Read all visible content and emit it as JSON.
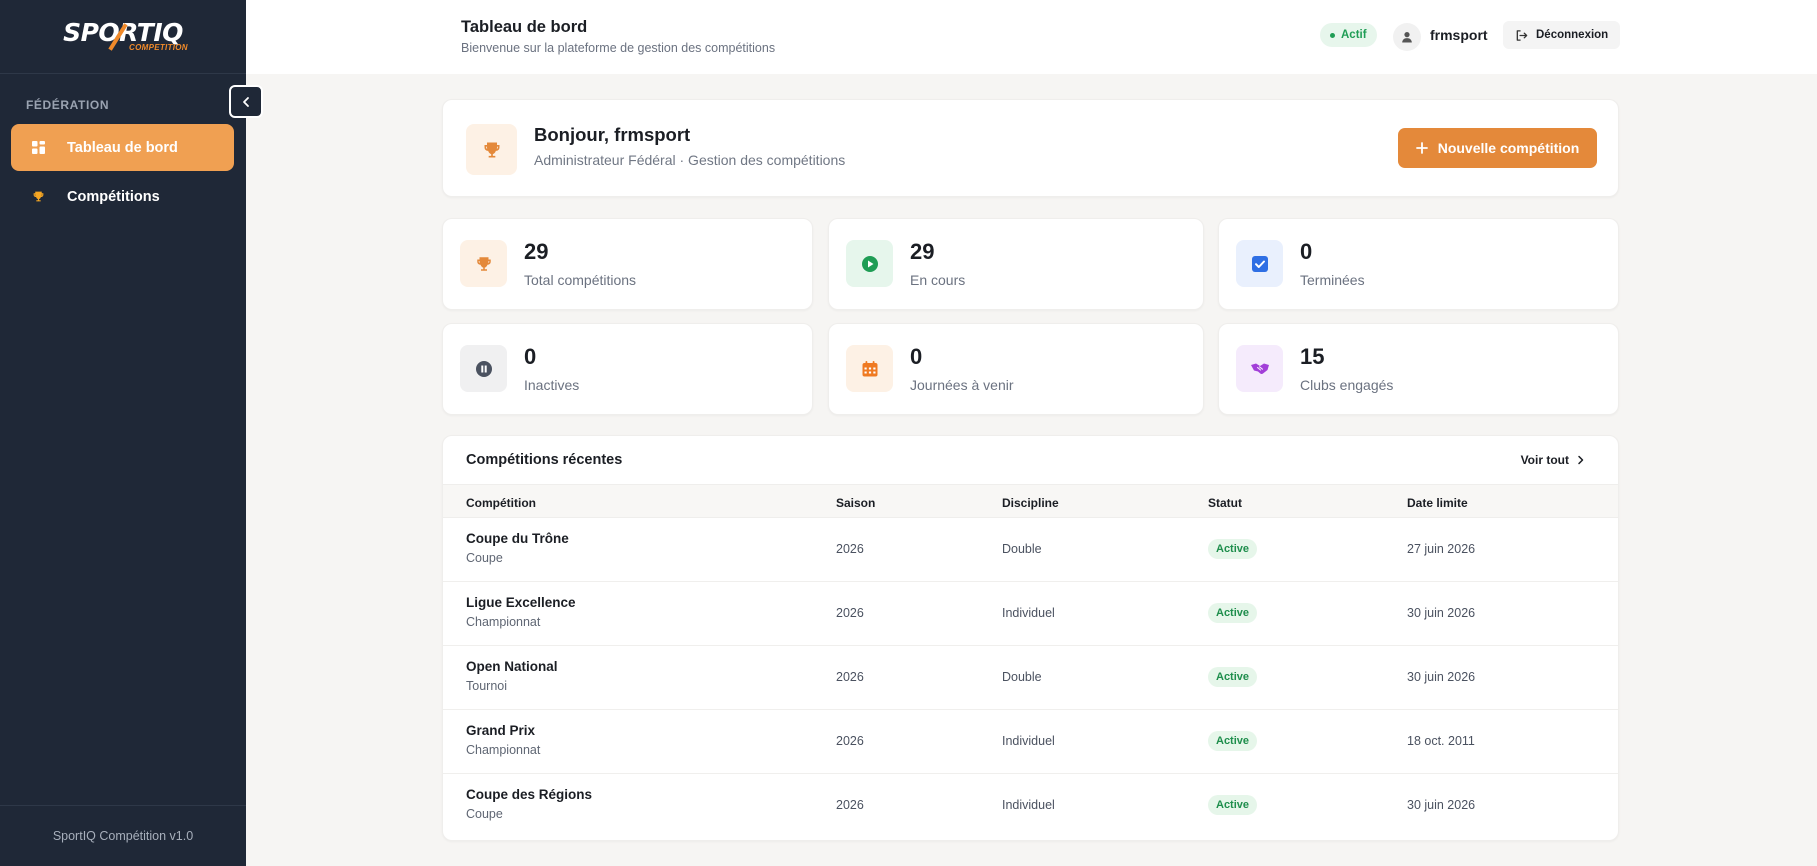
{
  "sidebar": {
    "logo": {
      "main": "SPORTIQ",
      "sub": "COMPETITION"
    },
    "section_label": "FÉDÉRATION",
    "items": [
      {
        "label": "Tableau de bord",
        "icon": "dashboard-icon",
        "active": true
      },
      {
        "label": "Compétitions",
        "icon": "trophy-icon",
        "active": false
      }
    ],
    "footer": "SportIQ Compétition v1.0"
  },
  "header": {
    "title": "Tableau de bord",
    "subtitle": "Bienvenue sur la plateforme de gestion des compétitions",
    "status_badge": "Actif",
    "username": "frmsport",
    "logout_label": "Déconnexion"
  },
  "welcome": {
    "greeting": "Bonjour, frmsport",
    "role": "Administrateur Fédéral · Gestion des compétitions",
    "new_button": "Nouvelle compétition"
  },
  "stats": [
    {
      "value": "29",
      "label": "Total compétitions",
      "icon": "trophy-icon",
      "color": "#e4893a",
      "bg": "#fdf1e5"
    },
    {
      "value": "29",
      "label": "En cours",
      "icon": "play-icon",
      "color": "#1f9d55",
      "bg": "#e6f6ec"
    },
    {
      "value": "0",
      "label": "Terminées",
      "icon": "check-icon",
      "color": "#2f6fe4",
      "bg": "#e9f0fd"
    },
    {
      "value": "0",
      "label": "Inactives",
      "icon": "pause-icon",
      "color": "#4b5260",
      "bg": "#f0f0f1"
    },
    {
      "value": "0",
      "label": "Journées à venir",
      "icon": "calendar-icon",
      "color": "#ef7a22",
      "bg": "#fdf1e5"
    },
    {
      "value": "15",
      "label": "Clubs engagés",
      "icon": "handshake-icon",
      "color": "#a23fd8",
      "bg": "#f5ebfc"
    }
  ],
  "recent": {
    "title": "Compétitions récentes",
    "see_all": "Voir tout",
    "columns": [
      "Compétition",
      "Saison",
      "Discipline",
      "Statut",
      "Date limite"
    ],
    "rows": [
      {
        "name": "Coupe du Trône",
        "type": "Coupe",
        "season": "2026",
        "discipline": "Double",
        "status": "Active",
        "deadline": "27 juin 2026"
      },
      {
        "name": "Ligue Excellence",
        "type": "Championnat",
        "season": "2026",
        "discipline": "Individuel",
        "status": "Active",
        "deadline": "30 juin 2026"
      },
      {
        "name": "Open National",
        "type": "Tournoi",
        "season": "2026",
        "discipline": "Double",
        "status": "Active",
        "deadline": "30 juin 2026"
      },
      {
        "name": "Grand Prix",
        "type": "Championnat",
        "season": "2026",
        "discipline": "Individuel",
        "status": "Active",
        "deadline": "18 oct. 2011"
      },
      {
        "name": "Coupe des Régions",
        "type": "Coupe",
        "season": "2026",
        "discipline": "Individuel",
        "status": "Active",
        "deadline": "30 juin 2026"
      }
    ]
  },
  "colors": {
    "accent": "#e4893a",
    "sidebar_bg": "#1f2837",
    "active_item": "#f0a052"
  }
}
